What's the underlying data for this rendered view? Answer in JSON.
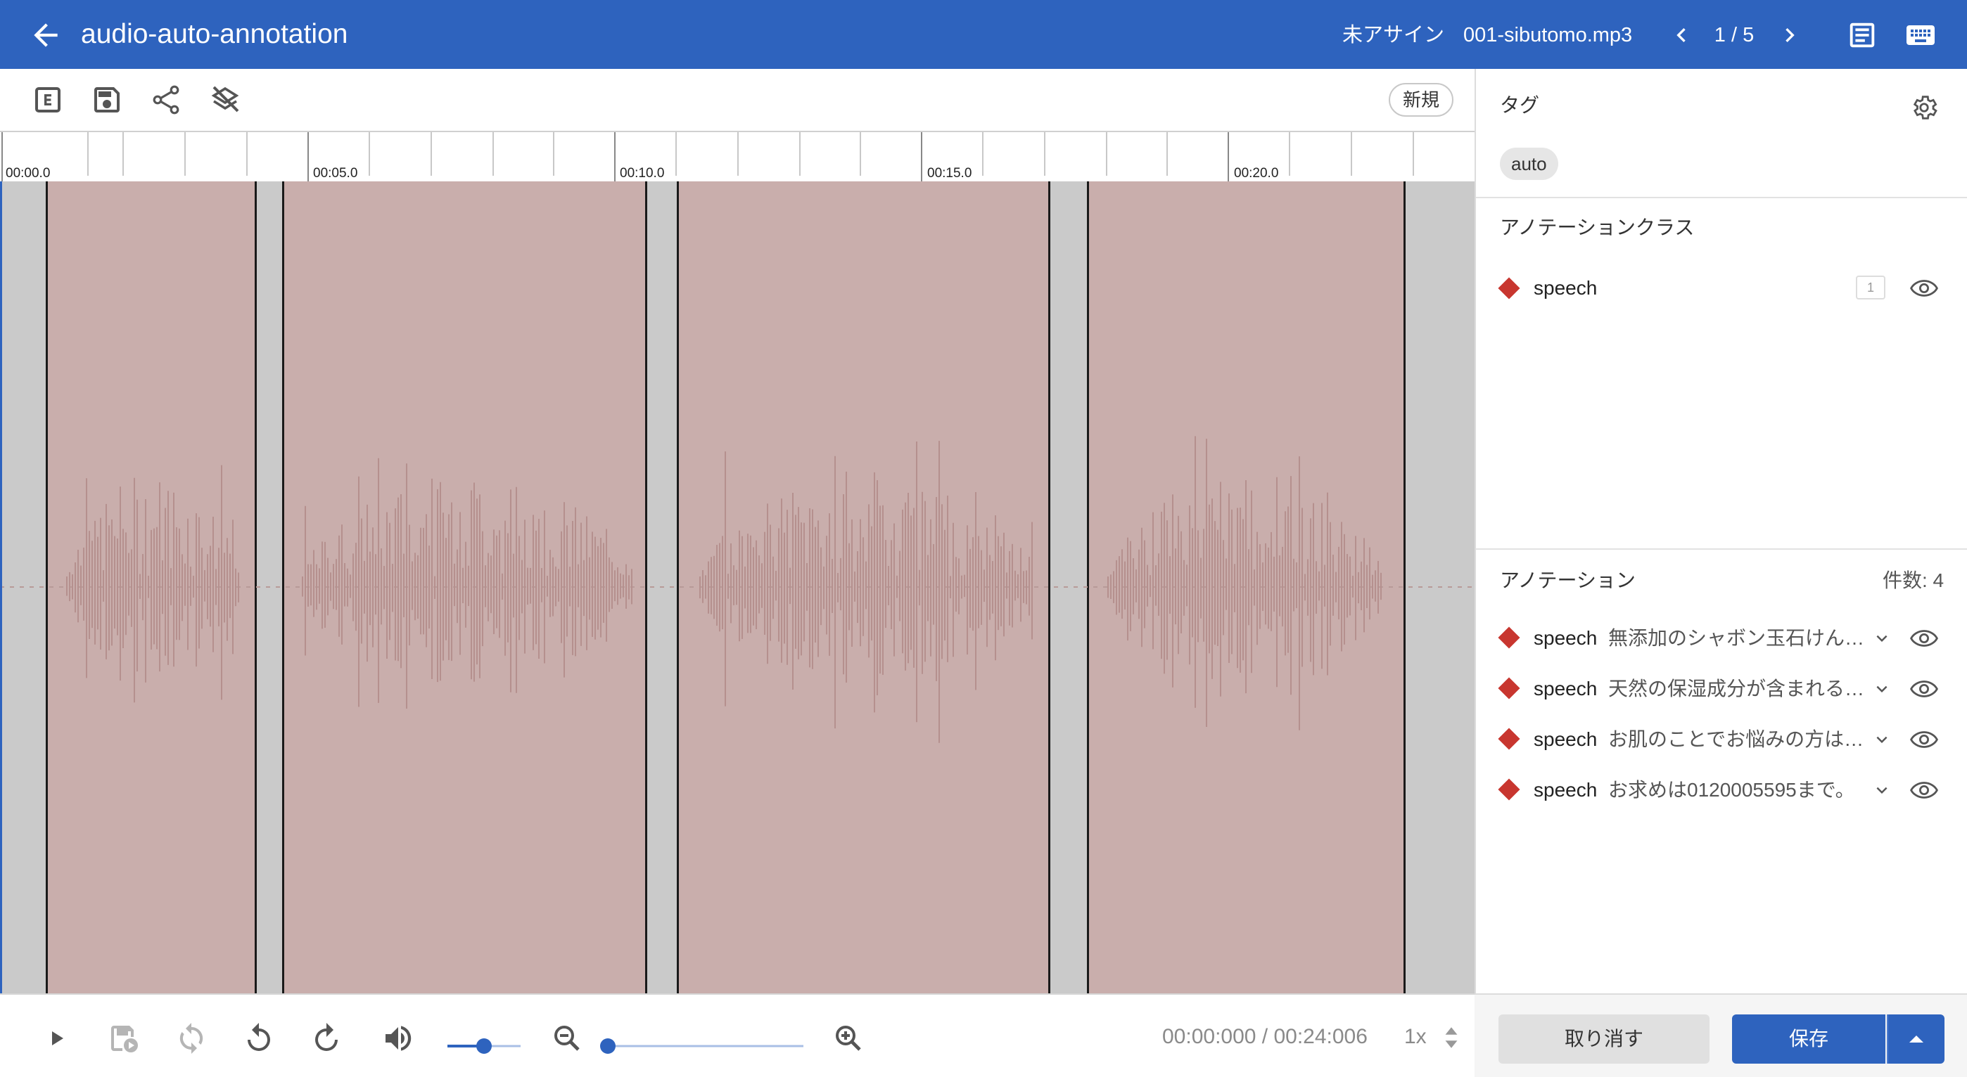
{
  "header": {
    "title": "audio-auto-annotation",
    "assign_status": "未アサイン",
    "file_name": "001-sibutomo.mp3",
    "page": "1 / 5",
    "icons": [
      "arrow-left-icon",
      "chevron-left-icon",
      "chevron-right-icon",
      "document-list-icon",
      "keyboard-icon"
    ]
  },
  "toolbar": {
    "icons": [
      "edit-square-icon",
      "save-icon",
      "share-icon",
      "layers-off-icon"
    ],
    "new_label": "新規"
  },
  "timeline": {
    "labels": [
      "00:00.0",
      "00:05.0",
      "00:10.0",
      "00:15.0",
      "00:20.0"
    ]
  },
  "player": {
    "time": "00:00:000 / 00:24:006",
    "rate": "1x",
    "volume_level": 0.5,
    "zoom_level": 0.0,
    "icons": [
      "play-icon",
      "play-region-icon",
      "loop-icon",
      "rewind-icon",
      "forward-icon",
      "volume-icon",
      "zoom-out-icon",
      "zoom-in-icon"
    ]
  },
  "sidebar": {
    "tags_title": "タグ",
    "tags": [
      "auto"
    ],
    "class_title": "アノテーションクラス",
    "classes": [
      {
        "name": "speech",
        "count": "1",
        "color": "#c8362f"
      }
    ],
    "annotations_title": "アノテーション",
    "annotations_count": "件数: 4",
    "annotations": [
      {
        "label": "speech",
        "text": "無添加のシャボン玉石けん…"
      },
      {
        "label": "speech",
        "text": "天然の保湿成分が含まれる…"
      },
      {
        "label": "speech",
        "text": "お肌のことでお悩みの方は…"
      },
      {
        "label": "speech",
        "text": "お求めは0120005595まで。"
      }
    ]
  },
  "footer": {
    "cancel_label": "取り消す",
    "save_label": "保存"
  },
  "colors": {
    "primary": "#2e63be",
    "region": "#c9aeac",
    "class_speech": "#c8362f"
  }
}
